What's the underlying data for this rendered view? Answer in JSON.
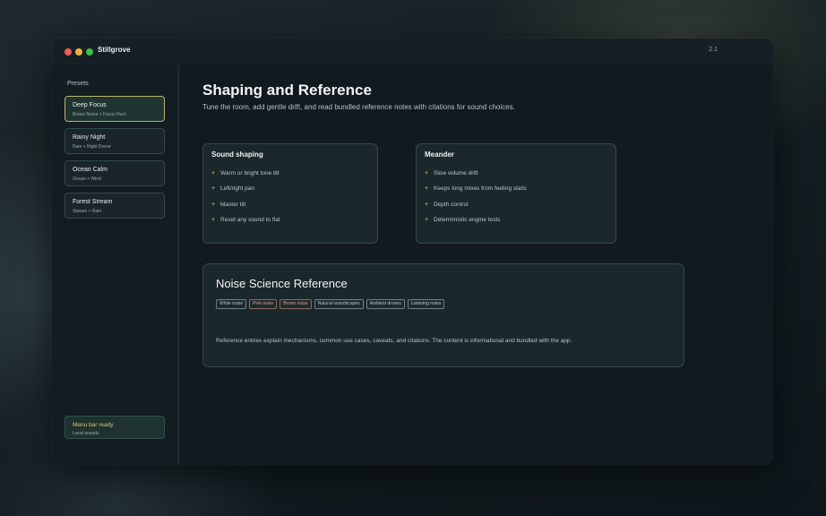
{
  "window": {
    "title": "Stillgrove",
    "version": "2.1"
  },
  "sidebar": {
    "heading": "Presets",
    "presets": [
      {
        "name": "Deep Focus",
        "subtitle": "Brown Noise + Focus Hum",
        "active": true
      },
      {
        "name": "Rainy Night",
        "subtitle": "Rain + Night Drone",
        "active": false
      },
      {
        "name": "Ocean Calm",
        "subtitle": "Ocean + Wind",
        "active": false
      },
      {
        "name": "Forest Stream",
        "subtitle": "Stream + Rain",
        "active": false
      }
    ],
    "status": {
      "title": "Menu bar ready",
      "subtitle": "Local sounds"
    }
  },
  "main": {
    "title": "Shaping and Reference",
    "subtitle": "Tune the room, add gentle drift, and read bundled reference notes with citations for sound choices.",
    "cards": [
      {
        "title": "Sound shaping",
        "items": [
          "Warm or bright tone tilt",
          "Left/right pan",
          "Master tilt",
          "Reset any sound to flat"
        ]
      },
      {
        "title": "Meander",
        "items": [
          "Slow volume drift",
          "Keeps long mixes from feeling static",
          "Depth control",
          "Deterministic engine tests"
        ]
      }
    ],
    "reference": {
      "title": "Noise Science Reference",
      "tags": [
        "White noise",
        "Pink noise",
        "Brown noise",
        "Natural soundscapes",
        "Ambient drones",
        "Listening notes"
      ],
      "note": "Reference entries explain mechanisms, common use cases, caveats, and citations. The content is informational and bundled with the app."
    }
  },
  "colors": {
    "accent": "#d0bb62",
    "active_border": "#b8b474",
    "close": "#ef5b58",
    "minimize": "#e9b23e",
    "maximize": "#3fbc49"
  }
}
